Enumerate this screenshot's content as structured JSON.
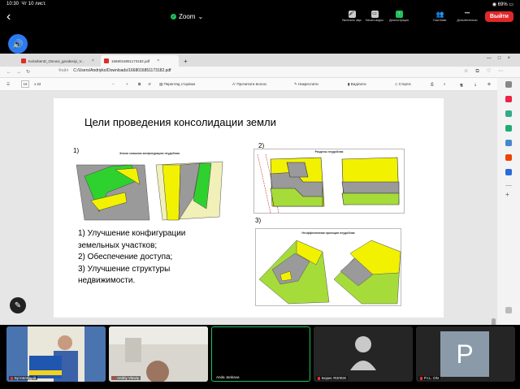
{
  "status": {
    "time": "10:30",
    "date": "Чт 10 лист.",
    "battery": "69%"
  },
  "zoom": {
    "title": "Zoom",
    "controls": [
      {
        "label": "Включить звук",
        "icon": "mic-muted-icon"
      },
      {
        "label": "Начать видео",
        "icon": "video-off-icon"
      },
      {
        "label": "Демонстрация",
        "icon": "share-icon"
      },
      {
        "label": "Участники",
        "icon": "participants-icon",
        "count": "34"
      },
      {
        "label": "Дополнительно",
        "icon": "more-icon"
      }
    ],
    "leave_label": "Выйти"
  },
  "browser": {
    "tabs": [
      {
        "label": "KolosbenD_Osnovi_geodesiyi_V..."
      },
      {
        "label": "1668016851173182.pdf"
      }
    ],
    "new_tab": "+",
    "url_prefix": "Файл",
    "url": "C:/Users/Andriyko/Downloads/1668016851173182.pdf",
    "pdf_toolbar": {
      "page_current": "19",
      "page_total": "з 22",
      "zoom_minus": "−",
      "zoom_plus": "+",
      "view_page": "Перегляд сторінки",
      "read_aloud": "Прочитати вголос",
      "draw": "Накреслити",
      "highlight": "Виділити",
      "erase": "Стерти"
    }
  },
  "slide": {
    "title": "Цели проведения консолидации земли",
    "fig_labels": [
      "1)",
      "2)",
      "3)"
    ],
    "fig1_caption": "Земля слишком конфигурацию неудобная",
    "fig2_caption": "Разделы неудобная",
    "fig3_caption": "Неэффективная проекция неудобная",
    "list": [
      "1)  Улучшение конфигурации",
      "     земельных участков;",
      "2)  Обеспечение  доступа;",
      "3)  Улучшение структуры",
      "     недвижимости."
    ]
  },
  "participants": [
    {
      "name": "БутовАндрій",
      "muted": true,
      "video": true
    },
    {
      "name": "Andriy Vitoviy",
      "muted": true,
      "video": true
    },
    {
      "name": "Anda Jankava",
      "muted": false,
      "video": false,
      "speaking": true
    },
    {
      "name": "Борис ЯЗЛЮК",
      "muted": true,
      "video": false
    },
    {
      "name": "P.I.L. ON",
      "muted": true,
      "video": false,
      "initial": "P"
    }
  ]
}
